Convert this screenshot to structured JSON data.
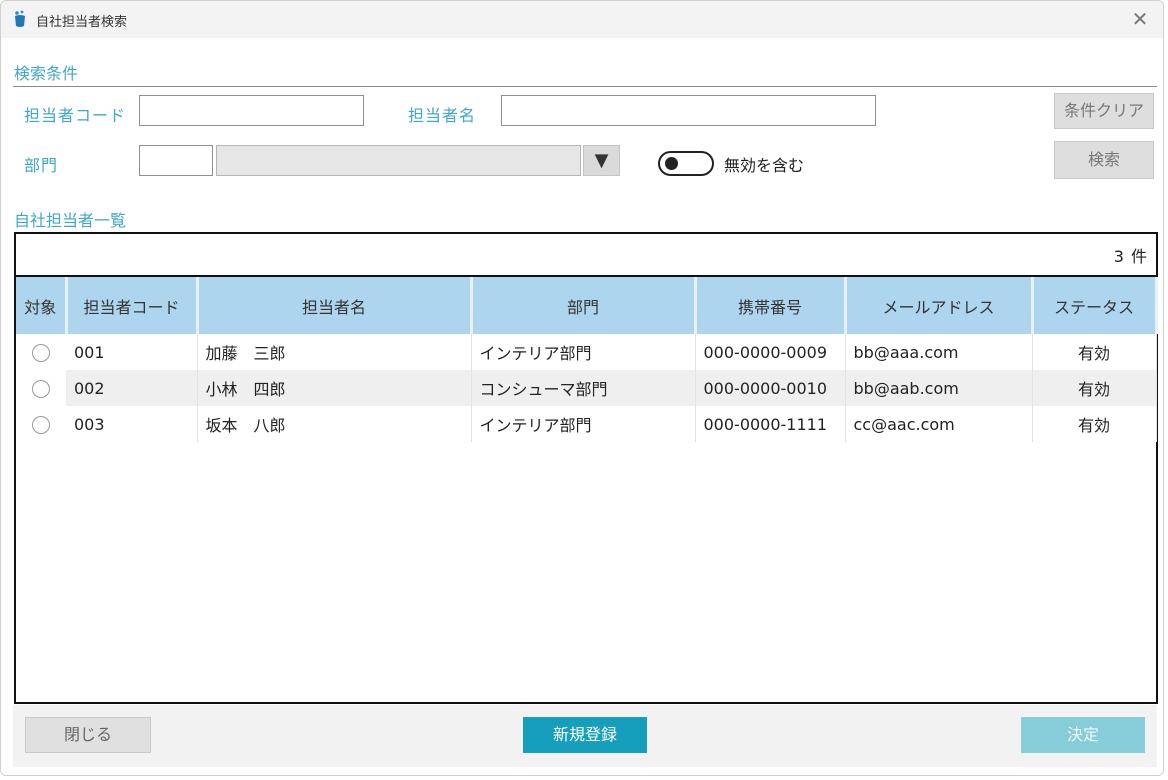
{
  "window": {
    "title": "自社担当者検索"
  },
  "search": {
    "section_title": "検索条件",
    "code_label": "担当者コード",
    "code_value": "",
    "name_label": "担当者名",
    "name_value": "",
    "dept_label": "部門",
    "dept_code_value": "",
    "dept_name_value": "",
    "include_invalid_label": "無効を含む",
    "include_invalid_checked": false,
    "clear_button": "条件クリア",
    "search_button": "検索"
  },
  "list": {
    "section_title": "自社担当者一覧",
    "count": "3 件",
    "columns": [
      "対象",
      "担当者コード",
      "担当者名",
      "部門",
      "携帯番号",
      "メールアドレス",
      "ステータス"
    ],
    "rows": [
      {
        "code": "001",
        "name": "加藤　三郎",
        "dept": "インテリア部門",
        "phone": "000-0000-0009",
        "email": "bb@aaa.com",
        "status": "有効"
      },
      {
        "code": "002",
        "name": "小林　四郎",
        "dept": "コンシューマ部門",
        "phone": "000-0000-0010",
        "email": "bb@aab.com",
        "status": "有効"
      },
      {
        "code": "003",
        "name": "坂本　八郎",
        "dept": "インテリア部門",
        "phone": "000-0000-1111",
        "email": "cc@aac.com",
        "status": "有効"
      }
    ]
  },
  "footer": {
    "close_button": "閉じる",
    "new_button": "新規登録",
    "decide_button": "決定"
  },
  "colors": {
    "accent": "#3fa7c8",
    "header_bg": "#add5ee",
    "primary_button": "#169fbc",
    "disabled_button": "#86ccd9"
  },
  "icons": {
    "app": "app-logo-icon",
    "close": "close-icon",
    "dropdown": "triangle-down-icon"
  }
}
